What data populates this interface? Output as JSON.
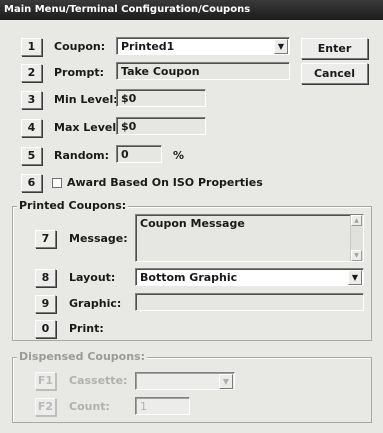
{
  "window": {
    "title": "Main Menu/Terminal Configuration/Coupons"
  },
  "actions": {
    "enter": "Enter",
    "cancel": "Cancel"
  },
  "fields": {
    "coupon": {
      "key": "1",
      "label": "Coupon:",
      "value": "Printed1"
    },
    "prompt": {
      "key": "2",
      "label": "Prompt:",
      "value": "Take Coupon"
    },
    "min_level": {
      "key": "3",
      "label": "Min Level:",
      "value": "$0"
    },
    "max_level": {
      "key": "4",
      "label": "Max Level:",
      "value": "$0"
    },
    "random": {
      "key": "5",
      "label": "Random:",
      "value": "0",
      "unit": "%"
    },
    "award": {
      "key": "6",
      "label": "Award Based On ISO Properties",
      "checked": false
    }
  },
  "printed": {
    "title": "Printed Coupons:",
    "message": {
      "key": "7",
      "label": "Message:",
      "value": "Coupon Message"
    },
    "layout": {
      "key": "8",
      "label": "Layout:",
      "value": "Bottom Graphic"
    },
    "graphic": {
      "key": "9",
      "label": "Graphic:",
      "value": ""
    },
    "print": {
      "key": "0",
      "label": "Print:"
    }
  },
  "dispensed": {
    "title": "Dispensed Coupons:",
    "cassette": {
      "key": "F1",
      "label": "Cassette:",
      "value": ""
    },
    "count": {
      "key": "F2",
      "label": "Count:",
      "value": "1"
    }
  },
  "icons": {
    "dropdown": "chevron-down-icon",
    "scroll_up": "scroll-up-icon",
    "scroll_down": "scroll-down-icon"
  }
}
